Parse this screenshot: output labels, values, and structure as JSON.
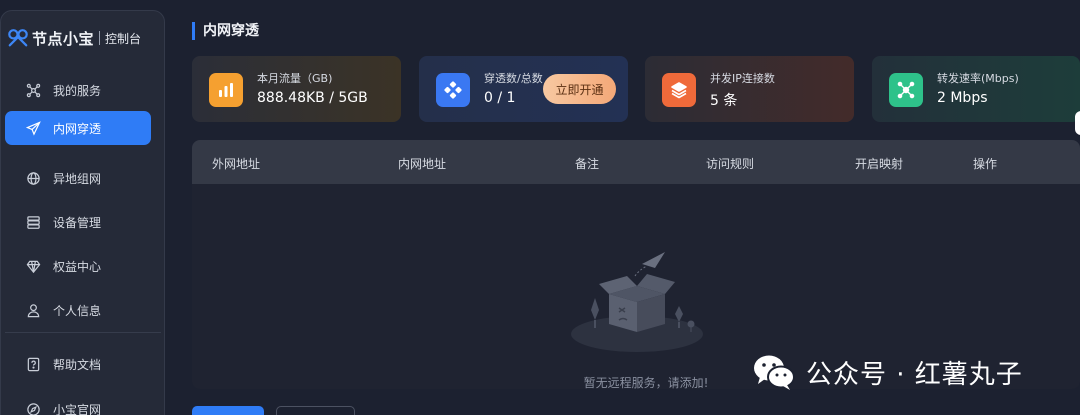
{
  "brand": {
    "name": "节点小宝",
    "subtitle": "控制台"
  },
  "sidebar": {
    "items": [
      {
        "label": "我的服务",
        "icon": "network-nodes-icon"
      },
      {
        "label": "内网穿透",
        "icon": "send-icon",
        "active": true
      },
      {
        "label": "异地组网",
        "icon": "globe-icon"
      },
      {
        "label": "设备管理",
        "icon": "server-icon"
      },
      {
        "label": "权益中心",
        "icon": "diamond-icon"
      },
      {
        "label": "个人信息",
        "icon": "user-icon"
      },
      {
        "label": "帮助文档",
        "icon": "help-doc-icon"
      },
      {
        "label": "小宝官网",
        "icon": "compass-icon"
      }
    ]
  },
  "page": {
    "title": "内网穿透"
  },
  "stats": [
    {
      "label": "本月流量（GB)",
      "value": "888.48KB / 5GB",
      "icon": "bar-chart-icon",
      "color": "#f5a030"
    },
    {
      "label": "穿透数/总数",
      "value": "0 / 1",
      "icon": "diamond-grid-icon",
      "color": "#3a78f2",
      "button": "立即开通"
    },
    {
      "label": "并发IP连接数",
      "value": "5 条",
      "icon": "layers-icon",
      "color": "#ef6a3a"
    },
    {
      "label": "转发速率(Mbps)",
      "value": "2 Mbps",
      "icon": "network-hub-icon",
      "color": "#2ec28a"
    }
  ],
  "table": {
    "columns": [
      "外网地址",
      "内网地址",
      "备注",
      "访问规则",
      "开启映射",
      "操作"
    ],
    "empty_text": "暂无远程服务，请添加!"
  },
  "watermark": {
    "text": "公众号 · 红薯丸子"
  }
}
